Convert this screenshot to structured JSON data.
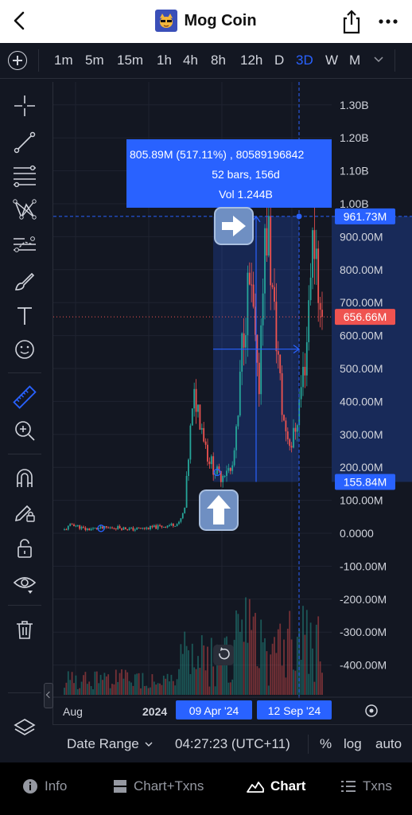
{
  "header": {
    "title": "Mog Coin",
    "logo_color": "#3a4fb8"
  },
  "timeframes": [
    {
      "label": "1m",
      "active": false
    },
    {
      "label": "5m",
      "active": false
    },
    {
      "label": "15m",
      "active": false
    },
    {
      "label": "1h",
      "active": false
    },
    {
      "label": "4h",
      "active": false
    },
    {
      "label": "8h",
      "active": false
    },
    {
      "label": "12h",
      "active": false
    },
    {
      "label": "D",
      "active": false
    },
    {
      "label": "3D",
      "active": true
    },
    {
      "label": "W",
      "active": false
    },
    {
      "label": "M",
      "active": false
    }
  ],
  "tools": [
    "crosshair-icon",
    "trend-line-icon",
    "fib-retracement-icon",
    "pattern-icon",
    "forecast-icon",
    "brush-icon",
    "text-icon",
    "emoji-icon",
    "ruler-icon",
    "zoom-in-icon",
    "magnet-icon",
    "lock-drawing-icon",
    "lock-icon",
    "eye-icon",
    "trash-icon"
  ],
  "chart_data": {
    "type": "candlestick",
    "price_axis_labels": [
      "1.30B",
      "1.20B",
      "1.10B",
      "1.00B",
      "900.00M",
      "800.00M",
      "700.00M",
      "600.00M",
      "500.00M",
      "400.00M",
      "300.00M",
      "200.00M",
      "100.00M",
      "0.0000",
      "-100.00M",
      "-200.00M",
      "-300.00M",
      "-400.00M"
    ],
    "price_axis_values": [
      1300,
      1200,
      1100,
      1000,
      900,
      800,
      700,
      600,
      500,
      400,
      300,
      200,
      100,
      0,
      -100,
      -200,
      -300,
      -400
    ],
    "time_axis_labels": [
      "Aug",
      "2024"
    ],
    "range_start_label": "09 Apr '24",
    "range_end_label": "12 Sep '24",
    "current_price_label": "656.66M",
    "current_price": 656.66,
    "measure_high_label": "961.73M",
    "measure_high": 961.73,
    "measure_low_label": "155.84M",
    "measure_low": 155.84,
    "measure_info": {
      "line1": "805.89M (517.11%) , 80589196842",
      "line2": "52 bars, 156d",
      "line3": "Vol 1.244B"
    },
    "up_color": "#26a69a",
    "down_color": "#ef5350",
    "accent_color": "#2962ff"
  },
  "bottom": {
    "date_range": "Date Range",
    "time": "04:27:23 (UTC+11)",
    "percent": "%",
    "log": "log",
    "auto": "auto"
  },
  "tabs": [
    {
      "label": "Info",
      "icon": "info-icon",
      "active": false
    },
    {
      "label": "Chart+Txns",
      "icon": "split-view-icon",
      "active": false
    },
    {
      "label": "Chart",
      "icon": "chart-mountain-icon",
      "active": true
    },
    {
      "label": "Txns",
      "icon": "list-icon",
      "active": false
    }
  ]
}
